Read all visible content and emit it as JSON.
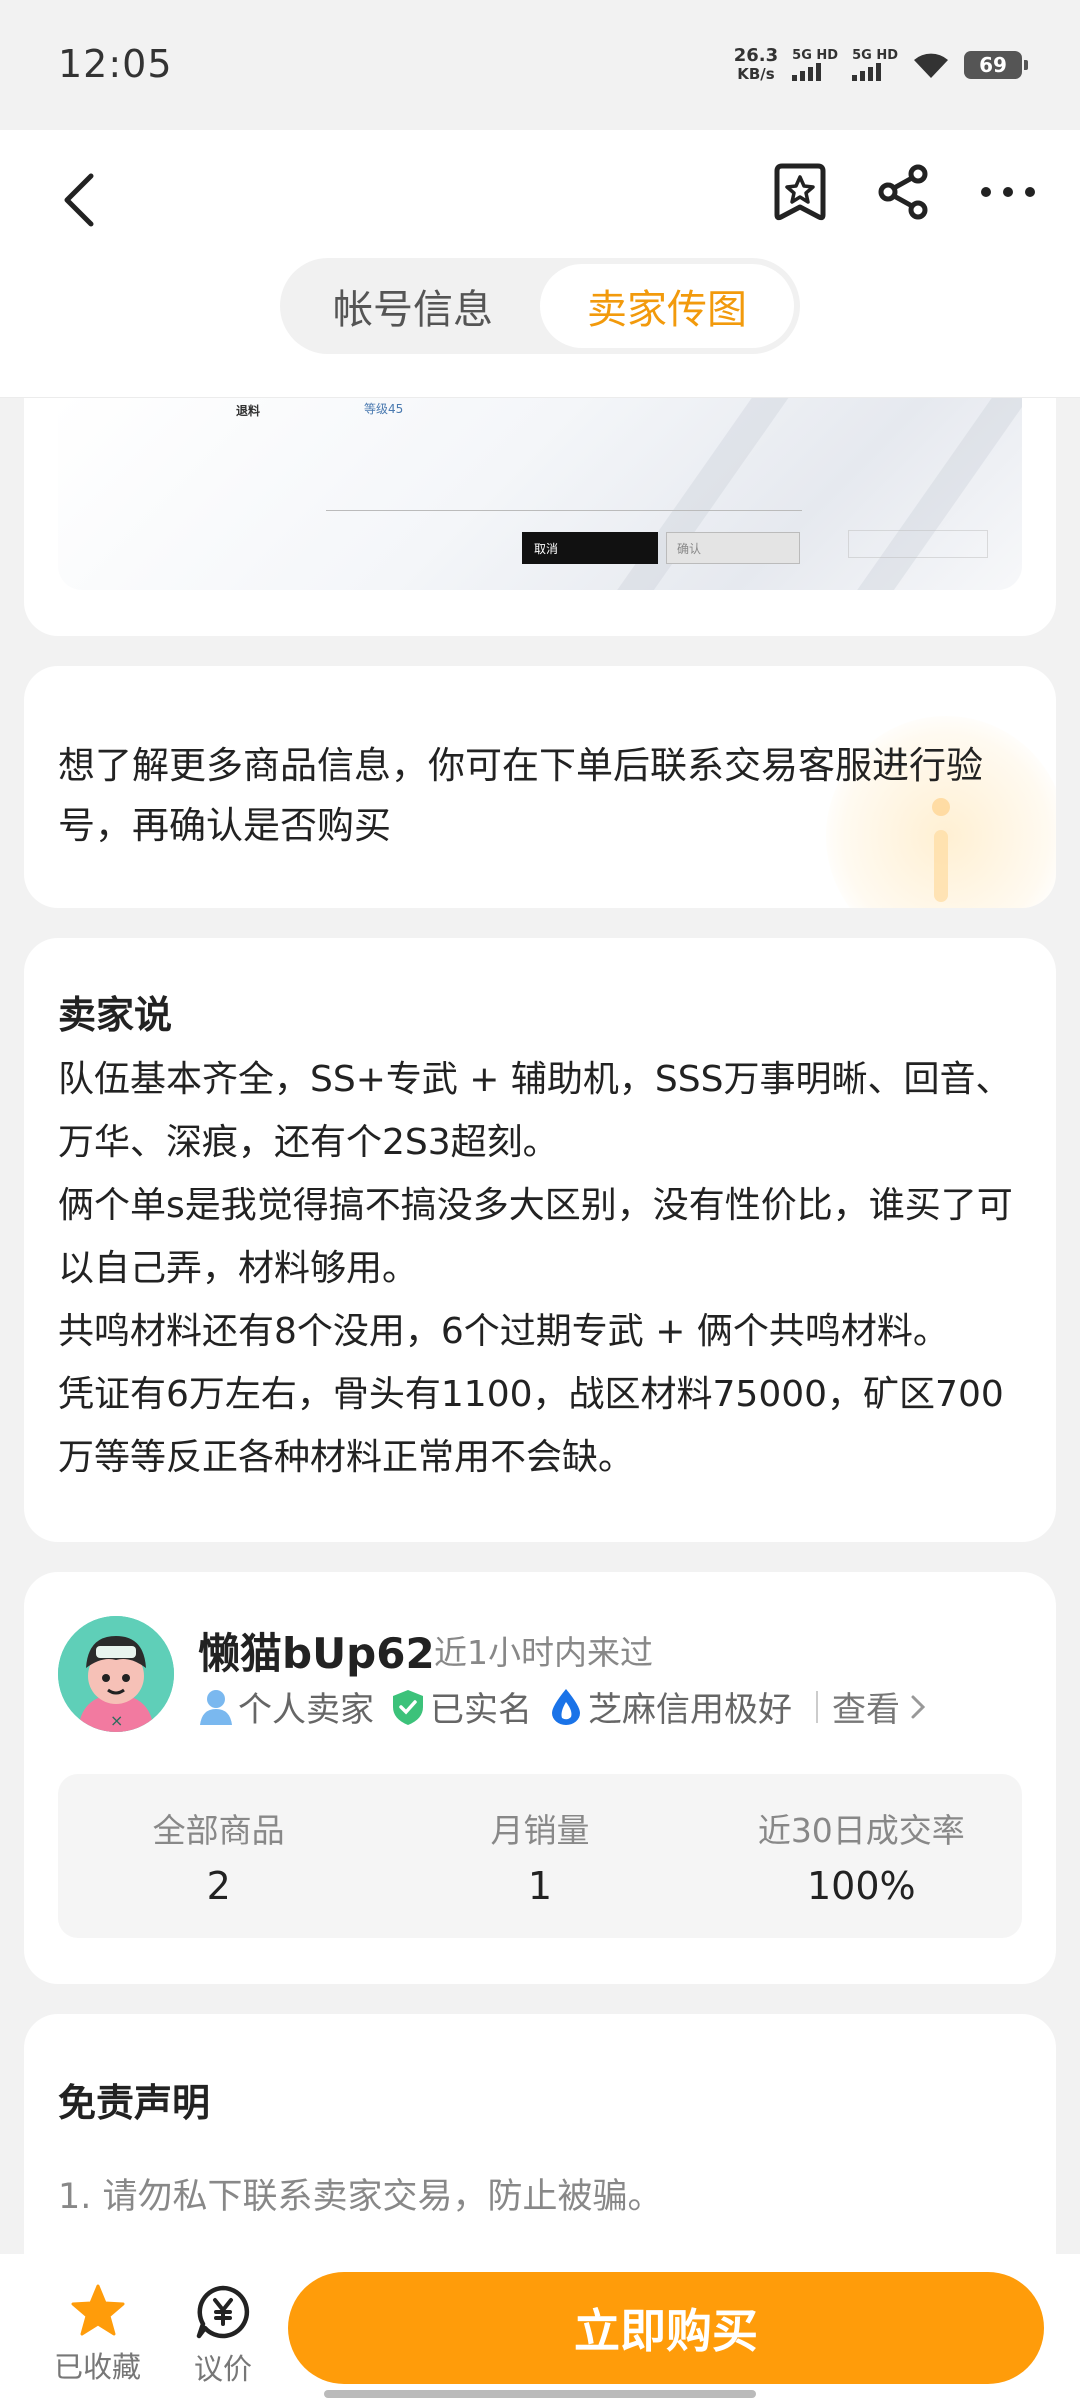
{
  "status_bar": {
    "time": "12:05",
    "net_speed_value": "26.3",
    "net_speed_unit": "KB/s",
    "sim1_label": "5G HD",
    "sim2_label": "5G HD",
    "battery": "69"
  },
  "header": {
    "tabs": [
      {
        "label": "帐号信息",
        "active": false
      },
      {
        "label": "卖家传图",
        "active": true
      }
    ]
  },
  "screenshot_preview": {
    "cancel_label": "取消",
    "confirm_label": "确认",
    "fragment_a": "退料",
    "fragment_b": "等级45"
  },
  "notice": {
    "text": "想了解更多商品信息，你可在下单后联系交易客服进行验号，再确认是否购买"
  },
  "seller_say": {
    "title": "卖家说",
    "paragraphs": [
      "队伍基本齐全，SS+专武 + 辅助机，SSS万事明晰、回音、万华、深痕，还有个2S3超刻。",
      "俩个单s是我觉得搞不搞没多大区别，没有性价比，谁买了可以自己弄，材料够用。",
      "共鸣材料还有8个没用，6个过期专武 + 俩个共鸣材料。",
      "凭证有6万左右，骨头有1100，战区材料75000，矿区700万等等反正各种材料正常用不会缺。"
    ]
  },
  "seller": {
    "name": "懒猫bUp62",
    "last_seen": "近1小时内来过",
    "badges": [
      "个人卖家",
      "已实名",
      "芝麻信用极好"
    ],
    "view_label": "查看",
    "stats": [
      {
        "label": "全部商品",
        "value": "2"
      },
      {
        "label": "月销量",
        "value": "1"
      },
      {
        "label": "近30日成交率",
        "value": "100%"
      }
    ]
  },
  "disclaimer": {
    "title": "免责声明",
    "items": [
      "1. 请勿私下联系卖家交易，防止被骗。"
    ]
  },
  "bottom_bar": {
    "favorite_label": "已收藏",
    "bargain_label": "议价",
    "buy_label": "立即购买"
  },
  "colors": {
    "accent": "#f29a0c",
    "buy_button": "#ff9c0a",
    "verified_green": "#3cc27a",
    "seller_blue": "#6aa8e8",
    "credit_blue": "#1a73e8"
  }
}
